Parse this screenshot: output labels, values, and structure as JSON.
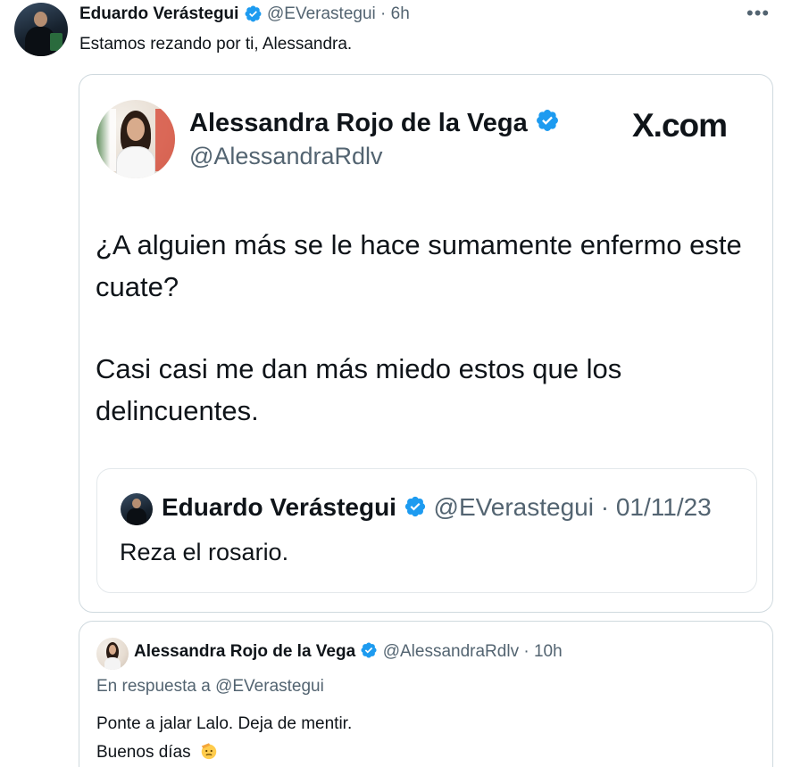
{
  "tweet": {
    "author_name": "Eduardo Verástegui",
    "author_handle": "@EVerastegui",
    "separator": "·",
    "time": "6h",
    "text": "Estamos rezando por ti, Alessandra.",
    "more_icon": "more-horizontal-icon"
  },
  "screenshot": {
    "author_name": "Alessandra Rojo de la Vega",
    "author_handle": "@AlessandraRdlv",
    "brand": "X.com",
    "text_paragraph_1": "¿A alguien más se le hace sumamente enfermo este cuate?",
    "text_paragraph_2": "Casi casi me dan más miedo estos que los delincuentes.",
    "quote": {
      "author_name": "Eduardo Verástegui",
      "author_handle": "@EVerastegui",
      "separator": "·",
      "date": "01/11/23",
      "text": "Reza el rosario."
    }
  },
  "reply": {
    "author_name": "Alessandra Rojo de la Vega",
    "author_handle": "@AlessandraRdlv",
    "separator": "·",
    "time": "10h",
    "context": "En respuesta a @EVerastegui",
    "line_1": "Ponte a jalar Lalo. Deja de mentir.",
    "line_2": "Buenos días",
    "emoji_icon": "saluting-face-icon"
  },
  "colors": {
    "verified_blue": "#1d9bf0",
    "secondary_text": "#536471",
    "border": "#cfd9de"
  }
}
